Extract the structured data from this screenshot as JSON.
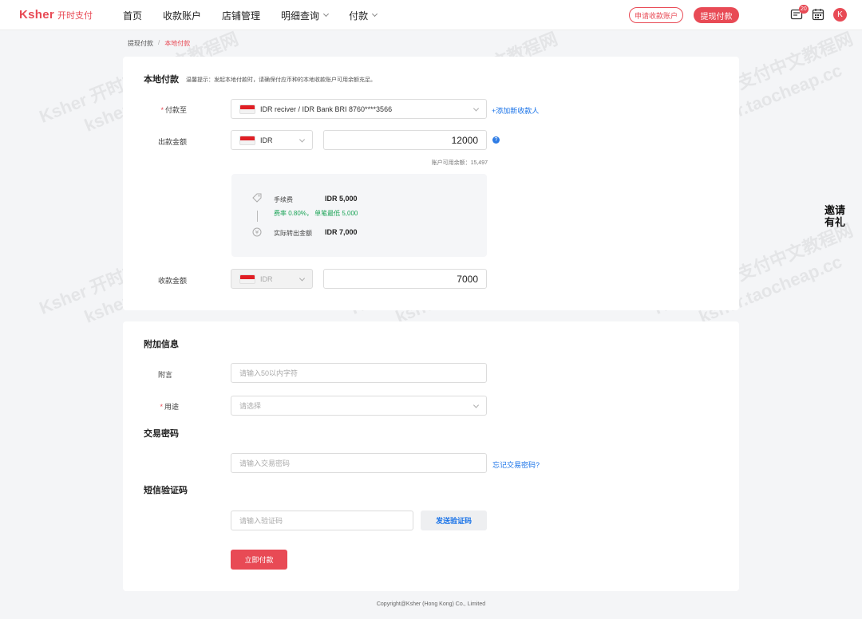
{
  "brand": {
    "en": "Ksher",
    "cn": "开时支付"
  },
  "nav": [
    {
      "label": "首页"
    },
    {
      "label": "收款账户"
    },
    {
      "label": "店铺管理"
    },
    {
      "label": "明细查询"
    },
    {
      "label": "付款"
    }
  ],
  "header": {
    "apply_account_label": "申请收款账户",
    "withdraw_label": "提现付款",
    "notification_count": "20",
    "avatar_letter": "K"
  },
  "breadcrumb": {
    "parent": "提现付款",
    "separator": "/",
    "current": "本地付款"
  },
  "local_payment": {
    "title": "本地付款",
    "hint": "温馨提示：发起本地付款时，请确保付应币种的本地收款账户可用余额充足。",
    "pay_to_label": "付款至",
    "pay_to_value": "IDR reciver / IDR Bank BRI 8760****3566",
    "add_payee_link": "+添加新收款人",
    "out_amount_label": "出款金额",
    "out_currency": "IDR",
    "out_amount": "12000",
    "info_icon": "?",
    "balance_text": "账户可用余额：15,497",
    "fee_label": "手续费",
    "fee_value": "IDR 5,000",
    "fee_rate": "费率 0.80%， 单笔最低 5,000",
    "actual_label": "实际转出金额",
    "actual_value": "IDR 7,000",
    "receive_label": "收款金额",
    "receive_currency": "IDR",
    "receive_amount": "7000"
  },
  "extra": {
    "title": "附加信息",
    "remark_label": "附言",
    "remark_placeholder": "请输入50以内字符",
    "purpose_label": "用途",
    "purpose_placeholder": "请选择",
    "password_title": "交易密码",
    "password_placeholder": "请输入交易密码",
    "forgot_link": "忘记交易密码?",
    "sms_title": "短信验证码",
    "sms_placeholder": "请输入验证码",
    "send_code_label": "发送验证码",
    "pay_now_label": "立即付款"
  },
  "invite": {
    "line1": "邀请",
    "line2": "有礼"
  },
  "footer": "Copyright@Ksher (Hong Kong) Co., Limited",
  "watermark": {
    "line1": "Ksher 开时支付中文教程网",
    "line2": "ksher.taocheap.cc"
  },
  "colors": {
    "brand_red": "#e84a55",
    "link_blue": "#1a73e8",
    "green": "#19a355"
  },
  "icons": [
    "message-icon",
    "calendar-icon",
    "tag-icon",
    "yen-icon",
    "flag-icon"
  ]
}
